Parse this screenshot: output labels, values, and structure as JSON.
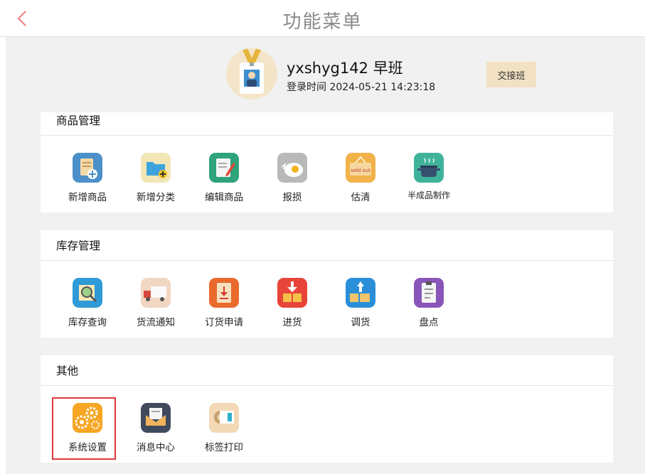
{
  "header": {
    "title": "功能菜单",
    "back_icon": "chevron-left-icon",
    "accent": "#f07a7a"
  },
  "profile": {
    "username": "yxshyg142 早班",
    "login_time": "登录时间 2024-05-21 14:23:18",
    "shift_button": "交接班",
    "avatar_icon": "staff-badge-icon"
  },
  "sections": [
    {
      "title": "商品管理",
      "items": [
        {
          "label": "新增商品",
          "icon": "add-product-icon"
        },
        {
          "label": "新增分类",
          "icon": "add-category-folder-icon"
        },
        {
          "label": "编辑商品",
          "icon": "edit-product-icon"
        },
        {
          "label": "报损",
          "icon": "broken-egg-icon"
        },
        {
          "label": "估清",
          "icon": "sold-out-icon",
          "icon_text": "sold out"
        },
        {
          "label": "半成品制作",
          "icon": "cooking-pot-icon"
        }
      ]
    },
    {
      "title": "库存管理",
      "items": [
        {
          "label": "库存查询",
          "icon": "inventory-search-icon"
        },
        {
          "label": "货流通知",
          "icon": "delivery-truck-icon"
        },
        {
          "label": "订货申请",
          "icon": "order-request-icon"
        },
        {
          "label": "进货",
          "icon": "stock-in-icon"
        },
        {
          "label": "调货",
          "icon": "transfer-goods-icon"
        },
        {
          "label": "盘点",
          "icon": "stocktake-checklist-icon"
        }
      ]
    },
    {
      "title": "其他",
      "items": [
        {
          "label": "系统设置",
          "icon": "settings-gears-icon",
          "selected": true
        },
        {
          "label": "消息中心",
          "icon": "message-envelope-icon"
        },
        {
          "label": "标签打印",
          "icon": "label-printer-icon"
        }
      ]
    }
  ],
  "colors": {
    "selected_border": "#e0373a",
    "shift_button_bg": "#f3e1c3",
    "page_bg": "#f1f1f1"
  }
}
